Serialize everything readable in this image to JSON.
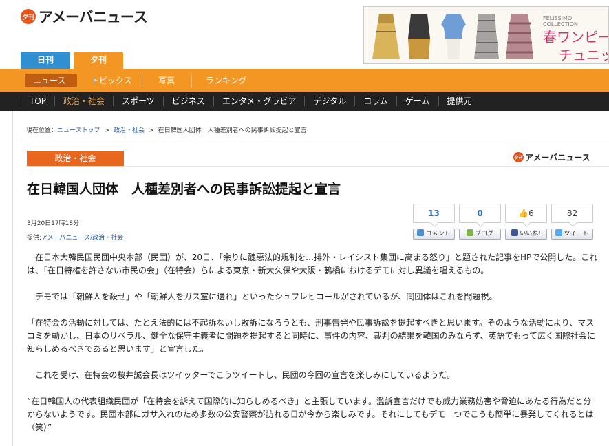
{
  "header": {
    "logo_badge": "夕刊",
    "logo_text": "アメーバニュース",
    "edition_tabs": [
      "日刊",
      "夕刊"
    ]
  },
  "ad": {
    "brand": "FELISSIMO COLLECTION",
    "line1": "春ワンピー",
    "line2": "チュニッ"
  },
  "orange_nav": [
    "ニュース",
    "トピックス",
    "写真",
    "ランキング"
  ],
  "black_nav": [
    "TOP",
    "政治・社会",
    "スポーツ",
    "ビジネス",
    "エンタメ・グラビア",
    "デジタル",
    "コラム",
    "ゲーム",
    "提供元"
  ],
  "breadcrumb": {
    "prefix": "現在位置：",
    "items": [
      "ニューストップ",
      "政治・社会",
      "在日韓国人団体　人種差別者への民事訴訟提起と宣言"
    ],
    "sep": ">"
  },
  "category": "政治・社会",
  "small_logo": {
    "badge": "夕刊",
    "text": "アメーバニュース"
  },
  "article": {
    "title": "在日韓国人団体　人種差別者への民事訴訟提起と宣言",
    "date": "3月20日17時18分",
    "source_label": "提供:",
    "source_value": "アメーバニュース/政治・社会",
    "paragraphs": [
      "在日本大韓民国民団中央本部（民団）が、20日、「余りに醜悪法的規制を…排外・レイシスト集団に高まる怒り」と題された記事をHPで公開した。これは、「在日特権を許さない市民の会」（在特会）らによる東京・新大久保や大阪・鶴橋におけるデモに対し異議を唱えるもの。",
      "デモでは「朝鮮人を殺せ」や「朝鮮人をガス室に送れ」といったシュプレヒコールがされているが、同団体はこれを問題視。",
      "「在特会の活動に対しては、たとえ法的には不起訴ないし敗訴になろうとも、刑事告発や民事訴訟を提起すべきと思います。そのような活動により、マスコミを動かし、日本のリベラル、健全な保守主義者に問題を提起すると同時に、事件の内容、裁判の結果を韓国のみならず、英語でもって広く国際社会に知らしめるべきであると思います」と宣言した。",
      "これを受け、在特会の桜井誠会長はツイッターでこうツイートし、民団の今回の宣言を楽しみにしているようだ。",
      "“在日韓国人の代表組織民団が「在特会を訴えて国際的に知らしめるべき」と主張しています。濫訴宣言だけでも威力業務妨害や脅迫にあたる行為だと分からないようです。民団本部にガサ入れのため多数の公安警察が訪れる日が今から楽しみです。それにしてもデモ一つでこうも簡単に暴発してくれるとは（笑）”"
    ]
  },
  "share": {
    "counts": [
      "13",
      "0",
      "6",
      "82"
    ],
    "buttons": [
      "コメント",
      "ブログ",
      "いいね!",
      "ツイート"
    ]
  }
}
